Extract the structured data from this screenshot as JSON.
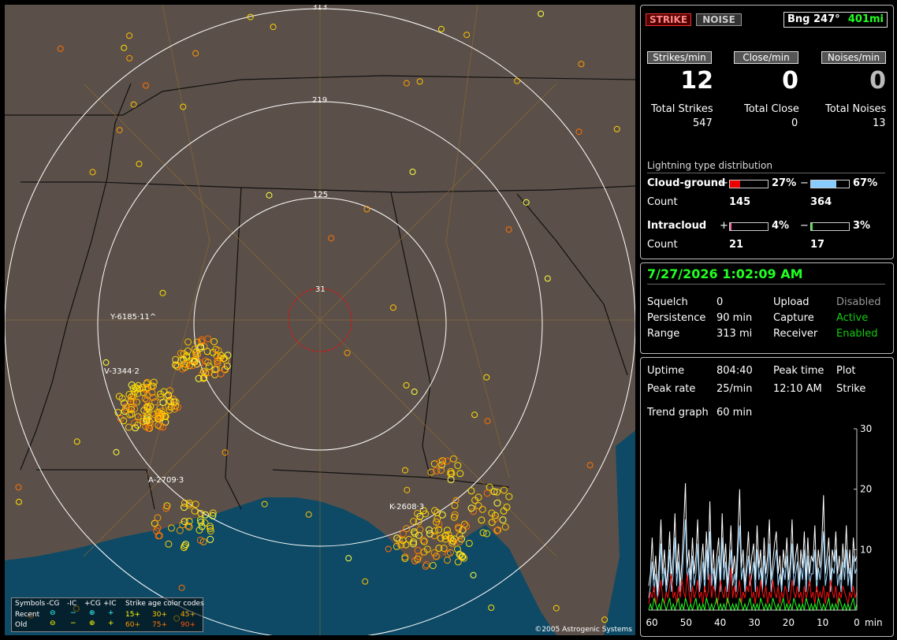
{
  "map": {
    "range_labels": [
      "313",
      "219",
      "125",
      "31"
    ],
    "storm_labels": [
      {
        "text": "Y-6185·11^"
      },
      {
        "text": "V-3344·2"
      },
      {
        "text": "A-2709·3"
      },
      {
        "text": "K-2608·3"
      }
    ],
    "copyright": "©2005 Astrogenic Systems",
    "legend": {
      "symbols_label": "Symbols",
      "col_minus_cg": "-CG",
      "col_minus_ic": "-IC",
      "col_plus_cg": "+CG",
      "col_plus_ic": "+IC",
      "age_title": "Strike age color codes",
      "recent_label": "Recent",
      "old_label": "Old",
      "recent_ages": [
        "15+",
        "30+",
        "45+"
      ],
      "old_ages": [
        "60+",
        "75+",
        "90+"
      ]
    },
    "colors": {
      "land": "#5b5049",
      "water": "#0e4a66",
      "recent_strike": "#ffe000",
      "old_strike": "#ff8000",
      "close_ring": "#e01010"
    }
  },
  "header": {
    "strike_btn": "STRIKE",
    "noise_btn": "NOISE",
    "bearing": "Bng 247°",
    "distance": "401mi"
  },
  "rates": {
    "strikes_label": "Strikes/min",
    "close_label": "Close/min",
    "noises_label": "Noises/min",
    "strikes_value": "12",
    "close_value": "0",
    "noises_value": "0"
  },
  "totals": {
    "strikes_label": "Total Strikes",
    "close_label": "Total Close",
    "noises_label": "Total Noises",
    "strikes_value": "547",
    "close_value": "0",
    "noises_value": "13"
  },
  "distribution": {
    "title": "Lightning type distribution",
    "cg_label": "Cloud-ground",
    "ic_label": "Intracloud",
    "count_label": "Count",
    "plus": "+",
    "minus": "−",
    "cg_plus_pct": "27%",
    "cg_minus_pct": "67%",
    "ic_plus_pct": "4%",
    "ic_minus_pct": "3%",
    "cg_plus_count": "145",
    "cg_minus_count": "364",
    "ic_plus_count": "21",
    "ic_minus_count": "17",
    "cg_plus_fraction": 0.27,
    "cg_minus_fraction": 0.67,
    "ic_plus_fraction": 0.04,
    "ic_minus_fraction": 0.03
  },
  "status": {
    "datetime": "7/27/2026 1:02:09 AM",
    "squelch_label": "Squelch",
    "squelch_value": "0",
    "persistence_label": "Persistence",
    "persistence_value": "90 min",
    "range_label": "Range",
    "range_value": "313 mi",
    "upload_label": "Upload",
    "upload_value": "Disabled",
    "capture_label": "Capture",
    "capture_value": "Active",
    "receiver_label": "Receiver",
    "receiver_value": "Enabled"
  },
  "stats": {
    "uptime_label": "Uptime",
    "uptime_value": "804:40",
    "peak_time_label": "Peak time",
    "peak_rate_label": "Peak rate",
    "peak_rate_value": "25/min",
    "peak_time_value": "12:10 AM",
    "plot_label": "Plot",
    "plot_value": "Strike",
    "trend_label": "Trend graph",
    "trend_value": "60 min"
  },
  "chart_data": {
    "type": "line",
    "xlabel": "min",
    "x_ticks": [
      "60",
      "50",
      "40",
      "30",
      "20",
      "10",
      "0"
    ],
    "y_ticks": [
      "30",
      "20",
      "10"
    ],
    "ylim": [
      0,
      30
    ],
    "xlim": [
      60,
      0
    ],
    "series": [
      {
        "color": "#ffffff",
        "values": [
          4,
          6,
          12,
          5,
          9,
          3,
          8,
          15,
          6,
          10,
          4,
          7,
          13,
          5,
          9,
          16,
          6,
          11,
          4,
          8,
          14,
          21,
          7,
          10,
          5,
          12,
          6,
          9,
          15,
          4,
          8,
          11,
          5,
          13,
          7,
          18,
          6,
          10,
          4,
          9,
          12,
          5,
          16,
          7,
          11,
          4,
          8,
          14,
          6,
          9,
          5,
          12,
          20,
          7,
          10,
          4,
          8,
          13,
          6,
          9,
          11,
          5,
          14,
          7,
          10,
          4,
          12,
          6,
          9,
          15,
          5,
          8,
          11,
          13,
          6,
          9,
          4,
          10,
          7,
          12,
          5,
          8,
          15,
          6,
          9,
          11,
          4,
          10,
          7,
          13,
          5,
          12,
          6,
          9,
          8,
          14,
          5,
          10,
          7,
          11,
          19,
          6,
          9,
          12,
          4,
          10,
          8,
          13,
          6,
          9,
          5,
          11,
          7,
          14,
          6,
          10,
          4,
          12,
          8,
          9
        ]
      },
      {
        "color": "#a0d8ff",
        "values": [
          2,
          4,
          8,
          3,
          6,
          2,
          5,
          11,
          4,
          7,
          3,
          5,
          10,
          3,
          6,
          12,
          4,
          8,
          3,
          5,
          10,
          15,
          5,
          7,
          3,
          9,
          4,
          6,
          11,
          3,
          5,
          8,
          3,
          10,
          5,
          13,
          4,
          7,
          3,
          6,
          9,
          3,
          12,
          5,
          8,
          3,
          6,
          10,
          4,
          6,
          3,
          9,
          14,
          5,
          7,
          3,
          6,
          9,
          4,
          6,
          8,
          3,
          10,
          5,
          7,
          3,
          9,
          4,
          6,
          11,
          3,
          6,
          8,
          10,
          4,
          6,
          3,
          7,
          5,
          9,
          3,
          6,
          11,
          4,
          6,
          8,
          3,
          7,
          5,
          10,
          3,
          9,
          4,
          6,
          6,
          10,
          3,
          7,
          5,
          8,
          13,
          4,
          6,
          9,
          3,
          7,
          6,
          10,
          4,
          6,
          3,
          8,
          5,
          10,
          4,
          7,
          3,
          9,
          6,
          7
        ]
      },
      {
        "color": "#ff1010",
        "values": [
          1,
          3,
          2,
          4,
          1,
          2,
          3,
          5,
          2,
          1,
          3,
          2,
          4,
          6,
          2,
          3,
          1,
          4,
          2,
          5,
          3,
          2,
          6,
          3,
          1,
          4,
          2,
          3,
          5,
          2,
          3,
          1,
          4,
          2,
          3,
          6,
          2,
          4,
          3,
          1,
          2,
          5,
          3,
          2,
          4,
          1,
          3,
          7,
          2,
          4,
          2,
          3,
          5,
          1,
          3,
          2,
          4,
          3,
          6,
          2,
          3,
          1,
          4,
          2,
          5,
          3,
          2,
          4,
          1,
          3,
          2,
          5,
          3,
          2,
          4,
          1,
          3,
          2,
          4,
          3,
          1,
          2,
          5,
          3,
          2,
          4,
          2,
          3,
          1,
          4,
          2,
          3,
          5,
          2,
          3,
          1,
          4,
          2,
          3,
          2,
          4,
          1,
          3,
          2,
          5,
          3,
          2,
          4,
          1,
          3,
          2,
          4,
          3,
          2,
          1,
          3,
          2,
          4,
          2,
          3
        ]
      },
      {
        "color": "#20ff20",
        "values": [
          0,
          1,
          0,
          2,
          1,
          0,
          1,
          0,
          2,
          1,
          0,
          1,
          2,
          0,
          1,
          0,
          1,
          2,
          0,
          1,
          0,
          2,
          1,
          0,
          1,
          0,
          1,
          2,
          0,
          1,
          0,
          1,
          0,
          2,
          1,
          0,
          1,
          0,
          1,
          2,
          0,
          1,
          0,
          1,
          0,
          2,
          1,
          0,
          1,
          0,
          1,
          0,
          2,
          1,
          0,
          1,
          0,
          1,
          2,
          0,
          1,
          0,
          1,
          0,
          2,
          1,
          0,
          1,
          0,
          1,
          0,
          2,
          1,
          0,
          1,
          0,
          1,
          2,
          0,
          1,
          0,
          1,
          0,
          2,
          1,
          0,
          1,
          0,
          1,
          0,
          2,
          1,
          0,
          1,
          0,
          1,
          0,
          2,
          1,
          0,
          1,
          0,
          1,
          2,
          0,
          1,
          0,
          1,
          0,
          2,
          1,
          0,
          1,
          0,
          1,
          0,
          1,
          2,
          0,
          1
        ]
      }
    ]
  }
}
